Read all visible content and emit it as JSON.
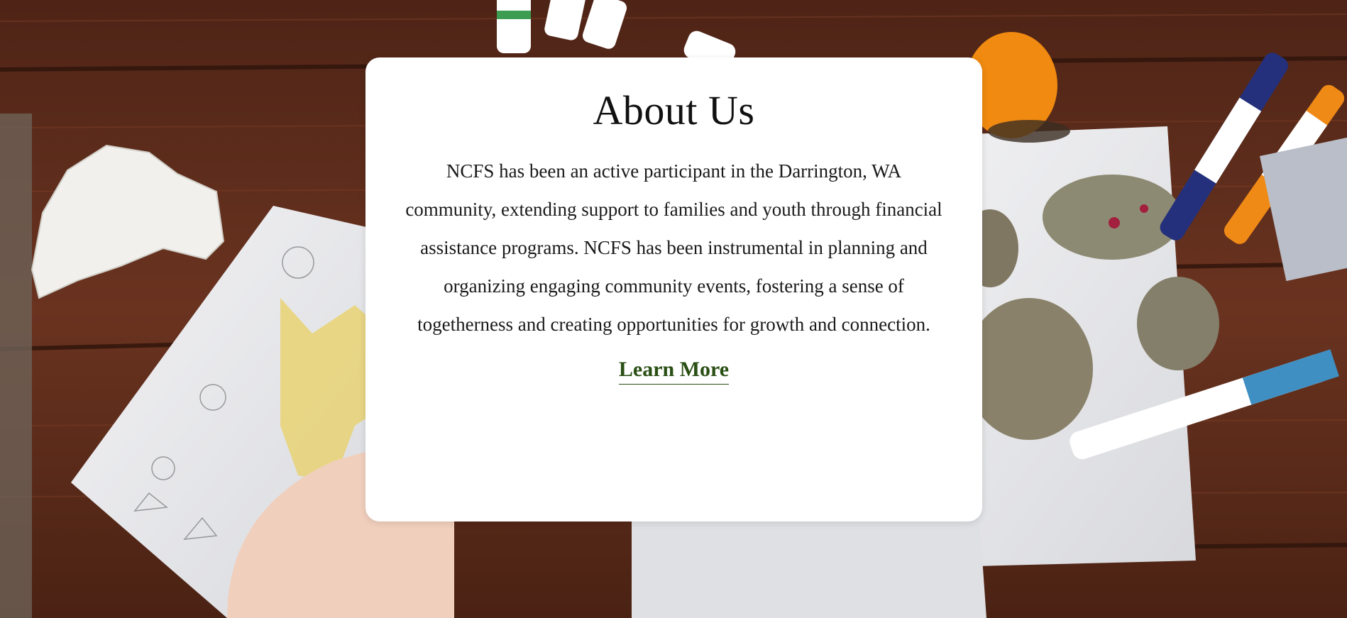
{
  "about": {
    "title": "About Us",
    "body": "NCFS has been an active participant in the Darrington, WA community, extending support to families and youth through financial assistance programs. NCFS has been instrumental in planning and organizing engaging community events, fostering a sense of togetherness and creating opportunities for growth and connection.",
    "cta_label": "Learn More"
  },
  "colors": {
    "card_background": "#ffffff",
    "title_text": "#111111",
    "body_text": "#1a1a1a",
    "cta_text": "#2a4f14",
    "table_wood": "#5a2c1b"
  }
}
